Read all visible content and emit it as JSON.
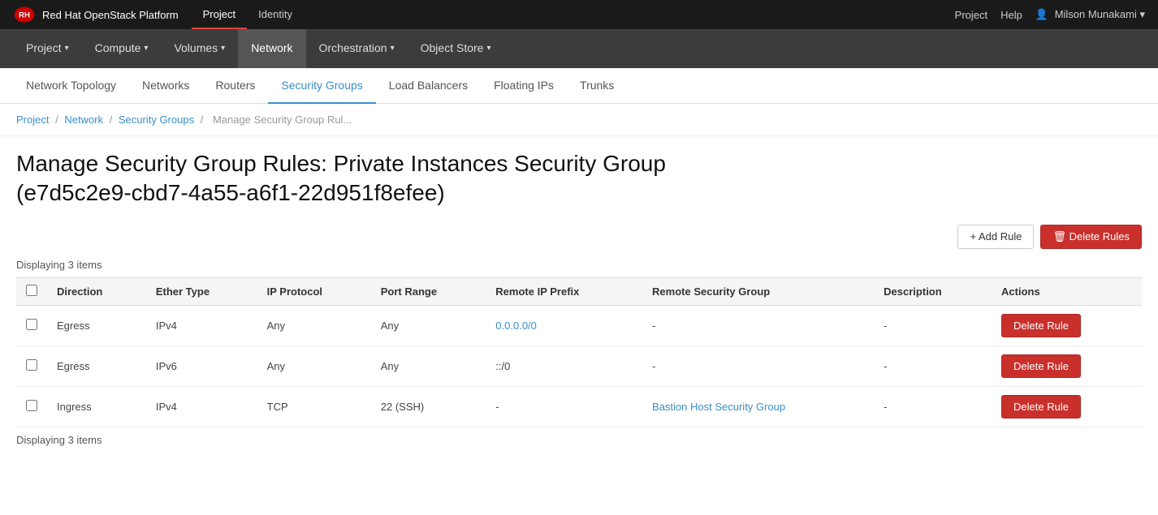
{
  "topbar": {
    "brand": "Red Hat OpenStack Platform",
    "tabs": [
      {
        "label": "Project",
        "active": true
      },
      {
        "label": "Identity",
        "active": false
      }
    ],
    "right": {
      "project_label": "Project",
      "help": "Help",
      "user": "Milson Munakami"
    }
  },
  "navbar": {
    "items": [
      {
        "label": "Project",
        "caret": true,
        "active": false
      },
      {
        "label": "Compute",
        "caret": true,
        "active": false
      },
      {
        "label": "Volumes",
        "caret": true,
        "active": false
      },
      {
        "label": "Network",
        "caret": false,
        "active": true
      },
      {
        "label": "Orchestration",
        "caret": true,
        "active": false
      },
      {
        "label": "Object Store",
        "caret": true,
        "active": false
      }
    ]
  },
  "subnav": {
    "items": [
      {
        "label": "Network Topology",
        "active": false
      },
      {
        "label": "Networks",
        "active": false
      },
      {
        "label": "Routers",
        "active": false
      },
      {
        "label": "Security Groups",
        "active": true
      },
      {
        "label": "Load Balancers",
        "active": false
      },
      {
        "label": "Floating IPs",
        "active": false
      },
      {
        "label": "Trunks",
        "active": false
      }
    ]
  },
  "breadcrumb": {
    "items": [
      {
        "label": "Project",
        "link": true
      },
      {
        "label": "Network",
        "link": true
      },
      {
        "label": "Security Groups",
        "link": true
      },
      {
        "label": "Manage Security Group Rul...",
        "link": false
      }
    ]
  },
  "page": {
    "title": "Manage Security Group Rules: Private Instances Security Group (e7d5c2e9-cbd7-4a55-a6f1-22d951f8efee)",
    "count_label_top": "Displaying 3 items",
    "count_label_bottom": "Displaying 3 items",
    "add_rule_label": "+ Add Rule",
    "delete_rules_label": "🗑 Delete Rules",
    "table": {
      "headers": [
        "",
        "Direction",
        "Ether Type",
        "IP Protocol",
        "Port Range",
        "Remote IP Prefix",
        "Remote Security Group",
        "Description",
        "Actions"
      ],
      "rows": [
        {
          "direction": "Egress",
          "ether_type": "IPv4",
          "ip_protocol": "Any",
          "port_range": "Any",
          "remote_ip_prefix": "0.0.0.0/0",
          "remote_security_group": "-",
          "description": "-",
          "action_label": "Delete Rule",
          "ip_link": true
        },
        {
          "direction": "Egress",
          "ether_type": "IPv6",
          "ip_protocol": "Any",
          "port_range": "Any",
          "remote_ip_prefix": "::/0",
          "remote_security_group": "-",
          "description": "-",
          "action_label": "Delete Rule",
          "ip_link": false
        },
        {
          "direction": "Ingress",
          "ether_type": "IPv4",
          "ip_protocol": "TCP",
          "port_range": "22 (SSH)",
          "remote_ip_prefix": "-",
          "remote_security_group": "Bastion Host Security Group",
          "description": "-",
          "action_label": "Delete Rule",
          "ip_link": false,
          "sg_link": true
        }
      ]
    }
  }
}
